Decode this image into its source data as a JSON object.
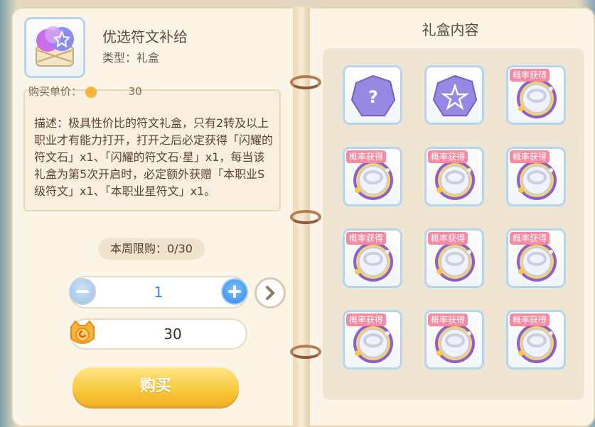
{
  "item": {
    "title": "优选符文补给",
    "type_label": "类型：礼盒",
    "price_partial": "购买单价：",
    "price_value": "30",
    "description": "描述：极具性价比的符文礼盒，只有2转及以上职业才有能力打开，打开之后必定获得「闪耀的符文石」x1、「闪耀的符文石·星」x1，每当该礼盒为第5次开启时，必定额外获赠「本职业S级符文」x1、「本职业星符文」x1。"
  },
  "purchase": {
    "weekly_limit": "本周限购：0/30",
    "quantity": "1",
    "cost": "30",
    "buy_label": "购买"
  },
  "gift": {
    "title": "礼盒内容",
    "badge_text": "概率获得",
    "items": [
      {
        "kind": "question-stone",
        "badge": false
      },
      {
        "kind": "star-stone",
        "badge": false
      },
      {
        "kind": "rune-ring",
        "badge": true
      },
      {
        "kind": "rune-ring",
        "badge": true
      },
      {
        "kind": "rune-ring",
        "badge": true
      },
      {
        "kind": "rune-ring",
        "badge": true
      },
      {
        "kind": "rune-ring",
        "badge": true
      },
      {
        "kind": "rune-ring",
        "badge": true
      },
      {
        "kind": "rune-ring",
        "badge": true
      },
      {
        "kind": "rune-ring",
        "badge": true
      },
      {
        "kind": "rune-ring",
        "badge": true
      },
      {
        "kind": "rune-ring",
        "badge": true
      }
    ]
  },
  "colors": {
    "accent_blue": "#2f86e6",
    "badge_pink": "#f58aa0",
    "buy_yellow": "#f7c83a"
  }
}
